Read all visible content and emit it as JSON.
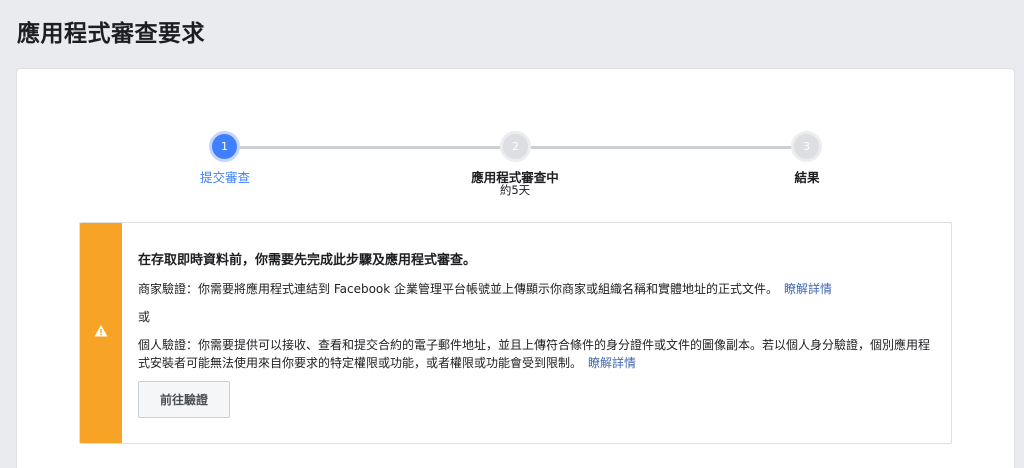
{
  "page": {
    "title": "應用程式審查要求"
  },
  "steps": [
    {
      "number": "1",
      "label": "提交審查",
      "sub": ""
    },
    {
      "number": "2",
      "label": "應用程式審查中",
      "sub": "約5天"
    },
    {
      "number": "3",
      "label": "結果",
      "sub": ""
    }
  ],
  "alert": {
    "icon": "warning-icon",
    "accent_color": "#f7a325",
    "heading": "在存取即時資料前，你需要先完成此步驟及應用程式審查。",
    "business_text": "商家驗證：你需要將應用程式連結到 Facebook 企業管理平台帳號並上傳顯示你商家或組織名稱和實體地址的正式文件。",
    "business_link": "瞭解詳情",
    "or_text": "或",
    "individual_text": "個人驗證：你需要提供可以接收、查看和提交合約的電子郵件地址，並且上傳符合條件的身分證件或文件的圖像副本。若以個人身分驗證，個別應用程式安裝者可能無法使用來自你要求的特定權限或功能，或者權限或功能會受到限制。",
    "individual_link": "瞭解詳情",
    "button_label": "前往驗證"
  }
}
